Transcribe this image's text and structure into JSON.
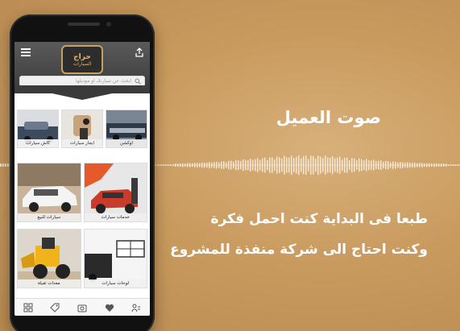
{
  "headline": "صوت العميل",
  "quote_lines": [
    "طبعا فى البداية كنت احمل فكرة",
    "وكنت احتاج الى شركة منفذة للمشروع"
  ],
  "app": {
    "logo_text": "حراج",
    "logo_sub": "السيارات",
    "search_placeholder": "ابحث عن سيارتك او موديلها",
    "categories_small": [
      {
        "label": "كاش سيارات"
      },
      {
        "label": "ايجار سيارات"
      },
      {
        "label": "اوكشن"
      }
    ],
    "categories_row2": [
      {
        "label": "سيارات للبيع"
      },
      {
        "label": "خدمات سيارات"
      }
    ],
    "categories_row3": [
      {
        "label": "معدات ثقيلة"
      },
      {
        "label": "لوحات سيارات"
      }
    ],
    "bottom_nav": [
      "grid-icon",
      "tag-icon",
      "camera-icon",
      "heart-icon",
      "users-icon"
    ]
  },
  "colors": {
    "background": "#c99a5e",
    "accent_gold": "#c9a15f",
    "text": "#ffffff"
  }
}
